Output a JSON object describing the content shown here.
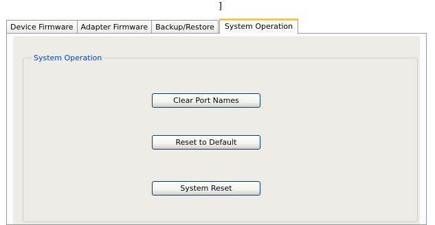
{
  "header": {
    "stray_text": "]"
  },
  "tabs": [
    {
      "label": "Device Firmware",
      "active": false
    },
    {
      "label": "Adapter Firmware",
      "active": false
    },
    {
      "label": "Backup/Restore",
      "active": false
    },
    {
      "label": "System Operation",
      "active": true
    }
  ],
  "group": {
    "legend": "System Operation",
    "legend_color": "#0046d5"
  },
  "buttons": {
    "clear_port_names": "Clear Port Names",
    "reset_to_default": "Reset to Default",
    "system_reset": "System Reset"
  },
  "colors": {
    "active_tab_highlight": "#ffc83c",
    "button_border": "#003c74",
    "panel_background": "#ecebe6"
  }
}
